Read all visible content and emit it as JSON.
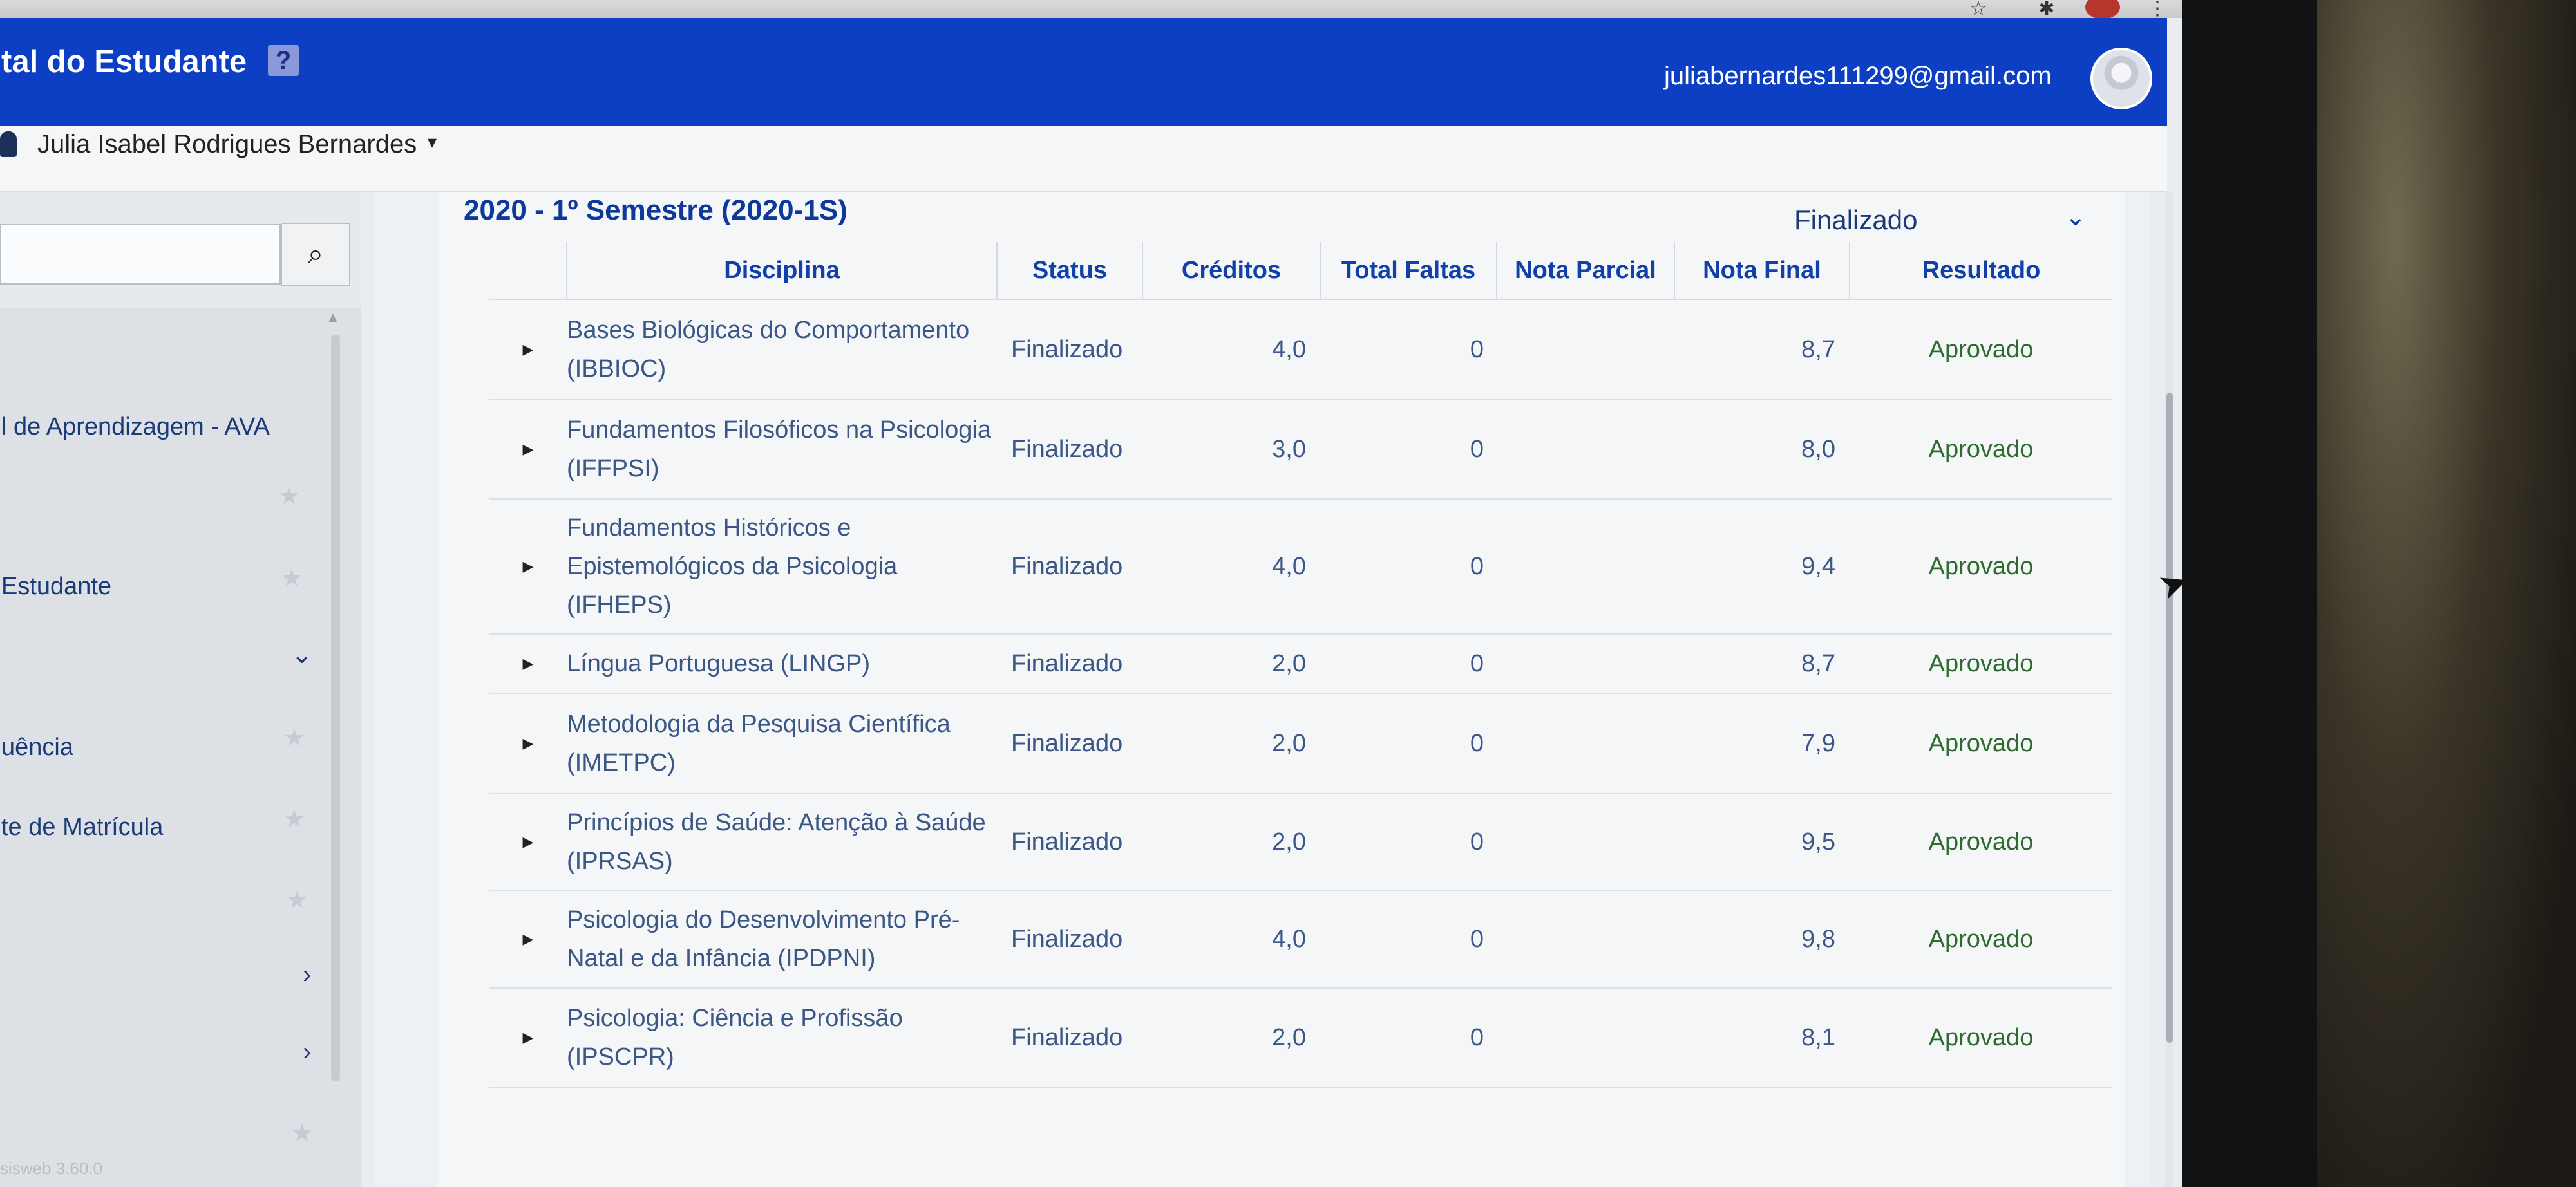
{
  "header": {
    "portal_title": "tal do Estudante",
    "help_icon": "?",
    "user_email": "juliabernardes111299@gmail.com"
  },
  "userbar": {
    "user_name": "Julia Isabel Rodrigues Bernardes",
    "caret": "▾"
  },
  "sidebar": {
    "search_placeholder": "",
    "items": [
      {
        "label": "l de Aprendizagem - AVA"
      },
      {
        "label": "Estudante"
      },
      {
        "label": "uência"
      },
      {
        "label": "te de Matrícula"
      }
    ],
    "version": "sisweb 3.60.0"
  },
  "semester": {
    "title": "2020 - 1º Semestre (2020-1S)",
    "status": "Finalizado"
  },
  "table": {
    "headers": [
      "Disciplina",
      "Status",
      "Créditos",
      "Total Faltas",
      "Nota Parcial",
      "Nota Final",
      "Resultado"
    ],
    "rows": [
      {
        "disciplina": "Bases Biológicas do Comportamento (IBBIOC)",
        "status": "Finalizado",
        "creditos": "4,0",
        "faltas": "0",
        "parcial": "",
        "final": "8,7",
        "resultado": "Aprovado"
      },
      {
        "disciplina": "Fundamentos Filosóficos na Psicologia (IFFPSI)",
        "status": "Finalizado",
        "creditos": "3,0",
        "faltas": "0",
        "parcial": "",
        "final": "8,0",
        "resultado": "Aprovado"
      },
      {
        "disciplina": "Fundamentos Históricos e Epistemológicos da Psicologia (IFHEPS)",
        "status": "Finalizado",
        "creditos": "4,0",
        "faltas": "0",
        "parcial": "",
        "final": "9,4",
        "resultado": "Aprovado"
      },
      {
        "disciplina": "Língua Portuguesa (LINGP)",
        "status": "Finalizado",
        "creditos": "2,0",
        "faltas": "0",
        "parcial": "",
        "final": "8,7",
        "resultado": "Aprovado"
      },
      {
        "disciplina": "Metodologia da Pesquisa Científica (IMETPC)",
        "status": "Finalizado",
        "creditos": "2,0",
        "faltas": "0",
        "parcial": "",
        "final": "7,9",
        "resultado": "Aprovado"
      },
      {
        "disciplina": "Princípios de Saúde: Atenção à Saúde (IPRSAS)",
        "status": "Finalizado",
        "creditos": "2,0",
        "faltas": "0",
        "parcial": "",
        "final": "9,5",
        "resultado": "Aprovado"
      },
      {
        "disciplina": "Psicologia do Desenvolvimento Pré-Natal e da Infância (IPDPNI)",
        "status": "Finalizado",
        "creditos": "4,0",
        "faltas": "0",
        "parcial": "",
        "final": "9,8",
        "resultado": "Aprovado"
      },
      {
        "disciplina": "Psicologia: Ciência e Profissão (IPSCPR)",
        "status": "Finalizado",
        "creditos": "2,0",
        "faltas": "0",
        "parcial": "",
        "final": "8,1",
        "resultado": "Aprovado"
      }
    ]
  }
}
